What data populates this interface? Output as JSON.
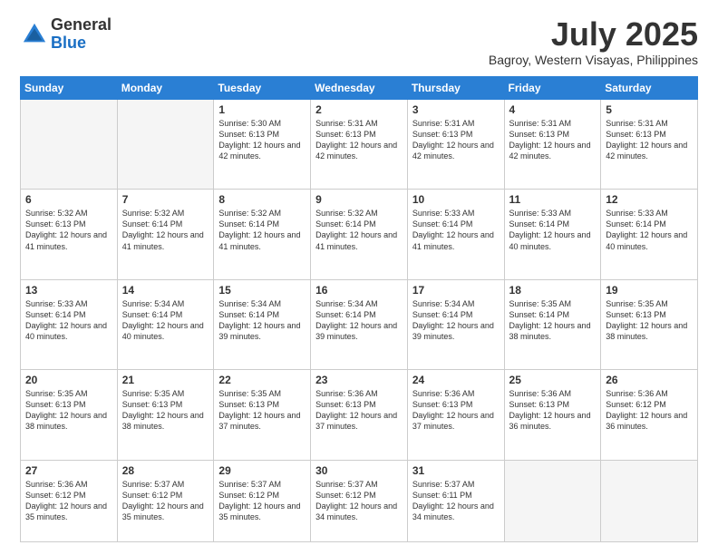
{
  "logo": {
    "general": "General",
    "blue": "Blue"
  },
  "title": "July 2025",
  "subtitle": "Bagroy, Western Visayas, Philippines",
  "days_of_week": [
    "Sunday",
    "Monday",
    "Tuesday",
    "Wednesday",
    "Thursday",
    "Friday",
    "Saturday"
  ],
  "weeks": [
    [
      {
        "day": "",
        "info": ""
      },
      {
        "day": "",
        "info": ""
      },
      {
        "day": "1",
        "info": "Sunrise: 5:30 AM\nSunset: 6:13 PM\nDaylight: 12 hours and 42 minutes."
      },
      {
        "day": "2",
        "info": "Sunrise: 5:31 AM\nSunset: 6:13 PM\nDaylight: 12 hours and 42 minutes."
      },
      {
        "day": "3",
        "info": "Sunrise: 5:31 AM\nSunset: 6:13 PM\nDaylight: 12 hours and 42 minutes."
      },
      {
        "day": "4",
        "info": "Sunrise: 5:31 AM\nSunset: 6:13 PM\nDaylight: 12 hours and 42 minutes."
      },
      {
        "day": "5",
        "info": "Sunrise: 5:31 AM\nSunset: 6:13 PM\nDaylight: 12 hours and 42 minutes."
      }
    ],
    [
      {
        "day": "6",
        "info": "Sunrise: 5:32 AM\nSunset: 6:13 PM\nDaylight: 12 hours and 41 minutes."
      },
      {
        "day": "7",
        "info": "Sunrise: 5:32 AM\nSunset: 6:14 PM\nDaylight: 12 hours and 41 minutes."
      },
      {
        "day": "8",
        "info": "Sunrise: 5:32 AM\nSunset: 6:14 PM\nDaylight: 12 hours and 41 minutes."
      },
      {
        "day": "9",
        "info": "Sunrise: 5:32 AM\nSunset: 6:14 PM\nDaylight: 12 hours and 41 minutes."
      },
      {
        "day": "10",
        "info": "Sunrise: 5:33 AM\nSunset: 6:14 PM\nDaylight: 12 hours and 41 minutes."
      },
      {
        "day": "11",
        "info": "Sunrise: 5:33 AM\nSunset: 6:14 PM\nDaylight: 12 hours and 40 minutes."
      },
      {
        "day": "12",
        "info": "Sunrise: 5:33 AM\nSunset: 6:14 PM\nDaylight: 12 hours and 40 minutes."
      }
    ],
    [
      {
        "day": "13",
        "info": "Sunrise: 5:33 AM\nSunset: 6:14 PM\nDaylight: 12 hours and 40 minutes."
      },
      {
        "day": "14",
        "info": "Sunrise: 5:34 AM\nSunset: 6:14 PM\nDaylight: 12 hours and 40 minutes."
      },
      {
        "day": "15",
        "info": "Sunrise: 5:34 AM\nSunset: 6:14 PM\nDaylight: 12 hours and 39 minutes."
      },
      {
        "day": "16",
        "info": "Sunrise: 5:34 AM\nSunset: 6:14 PM\nDaylight: 12 hours and 39 minutes."
      },
      {
        "day": "17",
        "info": "Sunrise: 5:34 AM\nSunset: 6:14 PM\nDaylight: 12 hours and 39 minutes."
      },
      {
        "day": "18",
        "info": "Sunrise: 5:35 AM\nSunset: 6:14 PM\nDaylight: 12 hours and 38 minutes."
      },
      {
        "day": "19",
        "info": "Sunrise: 5:35 AM\nSunset: 6:13 PM\nDaylight: 12 hours and 38 minutes."
      }
    ],
    [
      {
        "day": "20",
        "info": "Sunrise: 5:35 AM\nSunset: 6:13 PM\nDaylight: 12 hours and 38 minutes."
      },
      {
        "day": "21",
        "info": "Sunrise: 5:35 AM\nSunset: 6:13 PM\nDaylight: 12 hours and 38 minutes."
      },
      {
        "day": "22",
        "info": "Sunrise: 5:35 AM\nSunset: 6:13 PM\nDaylight: 12 hours and 37 minutes."
      },
      {
        "day": "23",
        "info": "Sunrise: 5:36 AM\nSunset: 6:13 PM\nDaylight: 12 hours and 37 minutes."
      },
      {
        "day": "24",
        "info": "Sunrise: 5:36 AM\nSunset: 6:13 PM\nDaylight: 12 hours and 37 minutes."
      },
      {
        "day": "25",
        "info": "Sunrise: 5:36 AM\nSunset: 6:13 PM\nDaylight: 12 hours and 36 minutes."
      },
      {
        "day": "26",
        "info": "Sunrise: 5:36 AM\nSunset: 6:12 PM\nDaylight: 12 hours and 36 minutes."
      }
    ],
    [
      {
        "day": "27",
        "info": "Sunrise: 5:36 AM\nSunset: 6:12 PM\nDaylight: 12 hours and 35 minutes."
      },
      {
        "day": "28",
        "info": "Sunrise: 5:37 AM\nSunset: 6:12 PM\nDaylight: 12 hours and 35 minutes."
      },
      {
        "day": "29",
        "info": "Sunrise: 5:37 AM\nSunset: 6:12 PM\nDaylight: 12 hours and 35 minutes."
      },
      {
        "day": "30",
        "info": "Sunrise: 5:37 AM\nSunset: 6:12 PM\nDaylight: 12 hours and 34 minutes."
      },
      {
        "day": "31",
        "info": "Sunrise: 5:37 AM\nSunset: 6:11 PM\nDaylight: 12 hours and 34 minutes."
      },
      {
        "day": "",
        "info": ""
      },
      {
        "day": "",
        "info": ""
      }
    ]
  ]
}
